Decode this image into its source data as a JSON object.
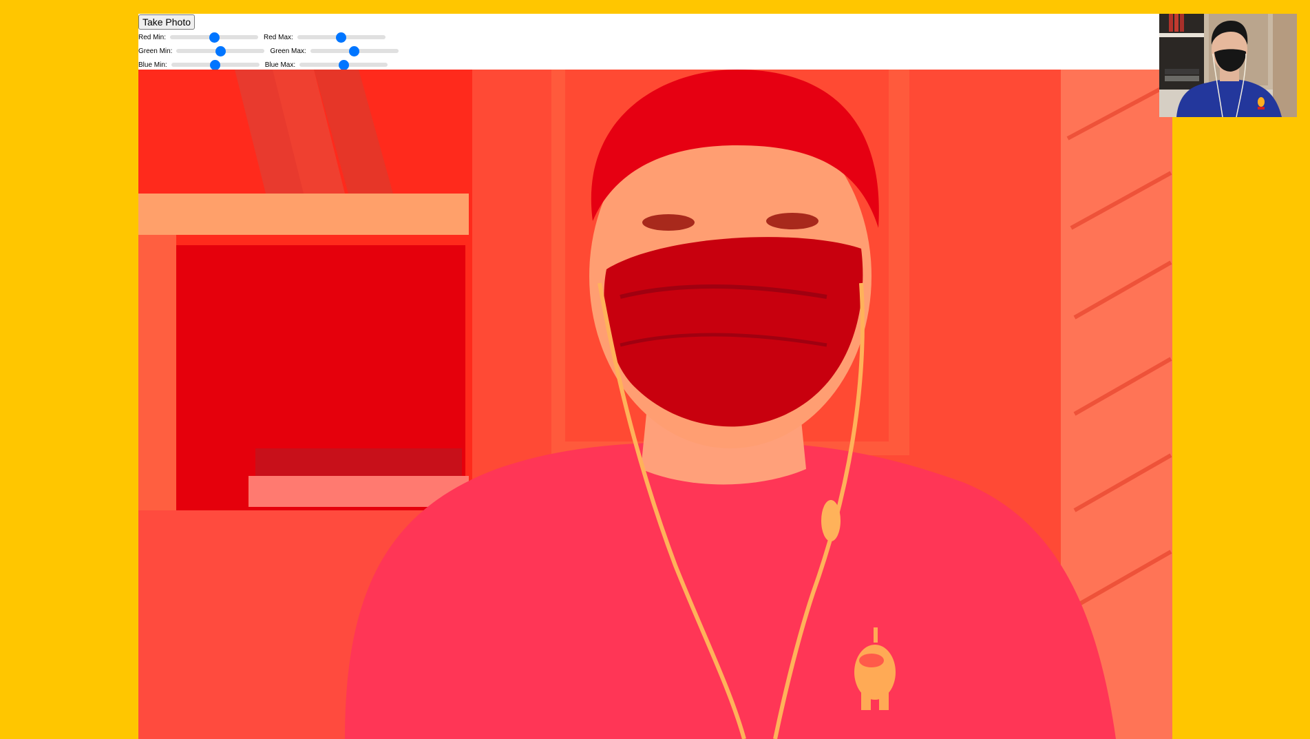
{
  "toolbar": {
    "take_photo_label": "Take Photo"
  },
  "sliders": {
    "red_min": {
      "label": "Red Min:",
      "value": 50
    },
    "red_max": {
      "label": "Red Max:",
      "value": 50
    },
    "green_min": {
      "label": "Green Min:",
      "value": 50
    },
    "green_max": {
      "label": "Green Max:",
      "value": 50
    },
    "blue_min": {
      "label": "Blue Min:",
      "value": 50
    },
    "blue_max": {
      "label": "Blue Max:",
      "value": 50
    }
  },
  "colors": {
    "background": "#FFC600",
    "slider_accent": "#0075ff",
    "filtered_tint": "#ff3a2a"
  }
}
